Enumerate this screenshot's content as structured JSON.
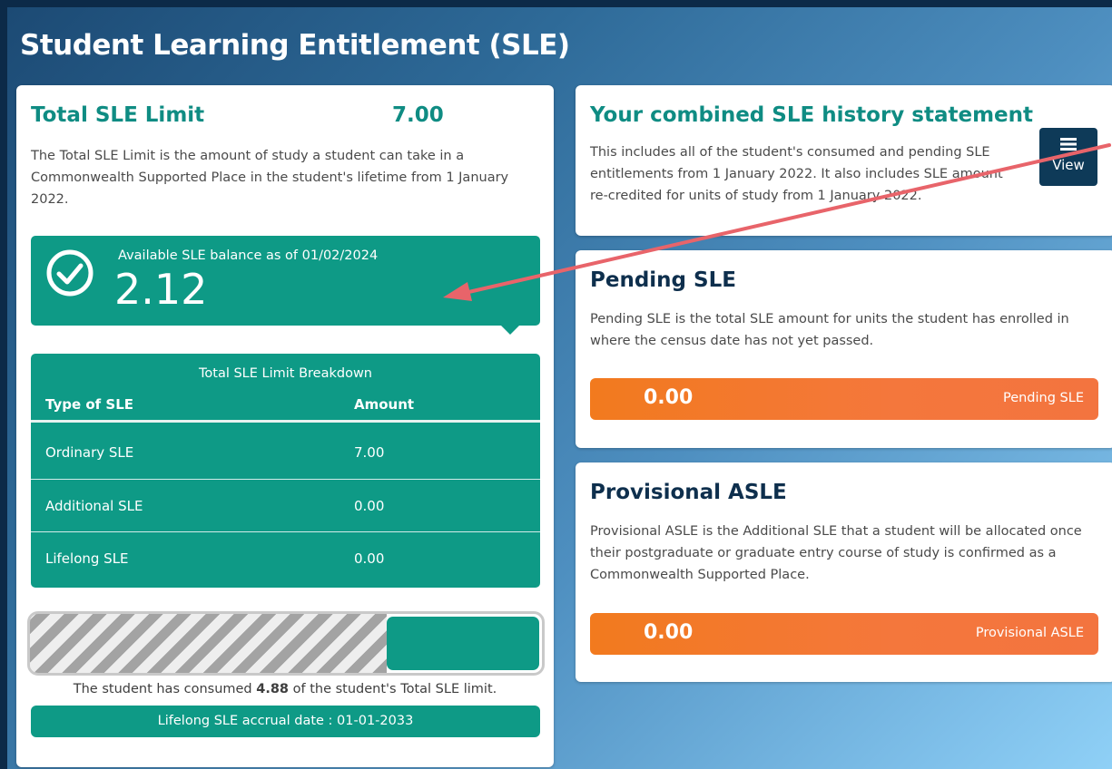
{
  "page": {
    "title": "Student Learning Entitlement (SLE)"
  },
  "total_limit": {
    "title": "Total SLE Limit",
    "value": "7.00",
    "description": "The Total SLE Limit is the amount of study a student can take in a Commonwealth Supported Place in the student's lifetime from 1 January 2022."
  },
  "balance": {
    "label": "Available SLE balance as of 01/02/2024",
    "value": "2.12",
    "icon": "check-circle-icon"
  },
  "breakdown": {
    "caption": "Total SLE Limit Breakdown",
    "headers": [
      "Type of SLE",
      "Amount"
    ],
    "rows": [
      {
        "type": "Ordinary SLE",
        "amount": "7.00"
      },
      {
        "type": "Additional SLE",
        "amount": "0.00"
      },
      {
        "type": "Lifelong SLE",
        "amount": "0.00"
      }
    ]
  },
  "consumption": {
    "consumed_fraction": 0.6971,
    "text_prefix": "The student has consumed ",
    "consumed_value": "4.88",
    "text_suffix": " of the student's Total SLE limit."
  },
  "accrual": {
    "text": "Lifelong SLE accrual date : 01-01-2033"
  },
  "history": {
    "title": "Your combined SLE history statement",
    "description": "This includes all of the student's consumed and pending SLE entitlements from 1 January 2022. It also includes SLE amount re-credited for units of study from 1 January 2022.",
    "view_label": "View",
    "view_icon": "list-icon"
  },
  "pending": {
    "title": "Pending SLE",
    "description": "Pending SLE is the total SLE amount for units the student has enrolled in where the census date has not yet passed.",
    "value": "0.00",
    "bar_label": "Pending SLE"
  },
  "provisional": {
    "title": "Provisional ASLE",
    "description": "Provisional ASLE is the Additional SLE that a student will be allocated once their postgraduate or graduate entry course of study is confirmed as a Commonwealth Supported Place.",
    "value": "0.00",
    "bar_label": "Provisional ASLE"
  },
  "colors": {
    "teal_title": "#0f8c83",
    "teal_panel": "#0e9a86",
    "navy": "#0e2f4d",
    "orange": "#f27a1e",
    "annotation_arrow": "#e8646a"
  }
}
